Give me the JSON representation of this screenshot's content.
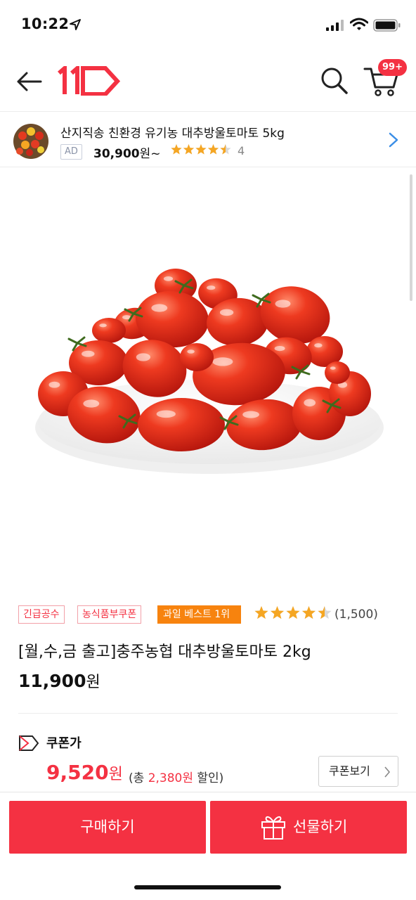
{
  "status_bar": {
    "time": "10:22"
  },
  "header": {
    "logo_text": "11",
    "cart_badge": "99+"
  },
  "ad": {
    "title": "산지직송 친환경 유기농 대추방울토마토 5kg",
    "label": "AD",
    "price": "30,900",
    "price_suffix": "원~",
    "rating_value": 4.5,
    "rating_text": "4"
  },
  "product": {
    "badges": [
      "긴급공수",
      "농식품부쿠폰"
    ],
    "best_badge": "과일 베스트 1위",
    "rating_value": 4.5,
    "review_count": "(1,500)",
    "title": "[월,수,금 출고]충주농협 대추방울토마토 2kg",
    "price": "11,900",
    "price_unit": "원"
  },
  "coupon": {
    "label": "쿠폰가",
    "price": "9,520",
    "price_unit": "원",
    "discount_prefix": "(총 ",
    "discount_amount": "2,380원",
    "discount_suffix": " 할인)",
    "view_button": "쿠폰보기"
  },
  "bottom_bar": {
    "buy_label": "구매하기",
    "gift_label": "선물하기"
  },
  "colors": {
    "brand_red": "#f43142",
    "best_orange": "#f7830e",
    "star_yellow": "#f5a623",
    "ad_chevron_blue": "#3a8ee6"
  }
}
